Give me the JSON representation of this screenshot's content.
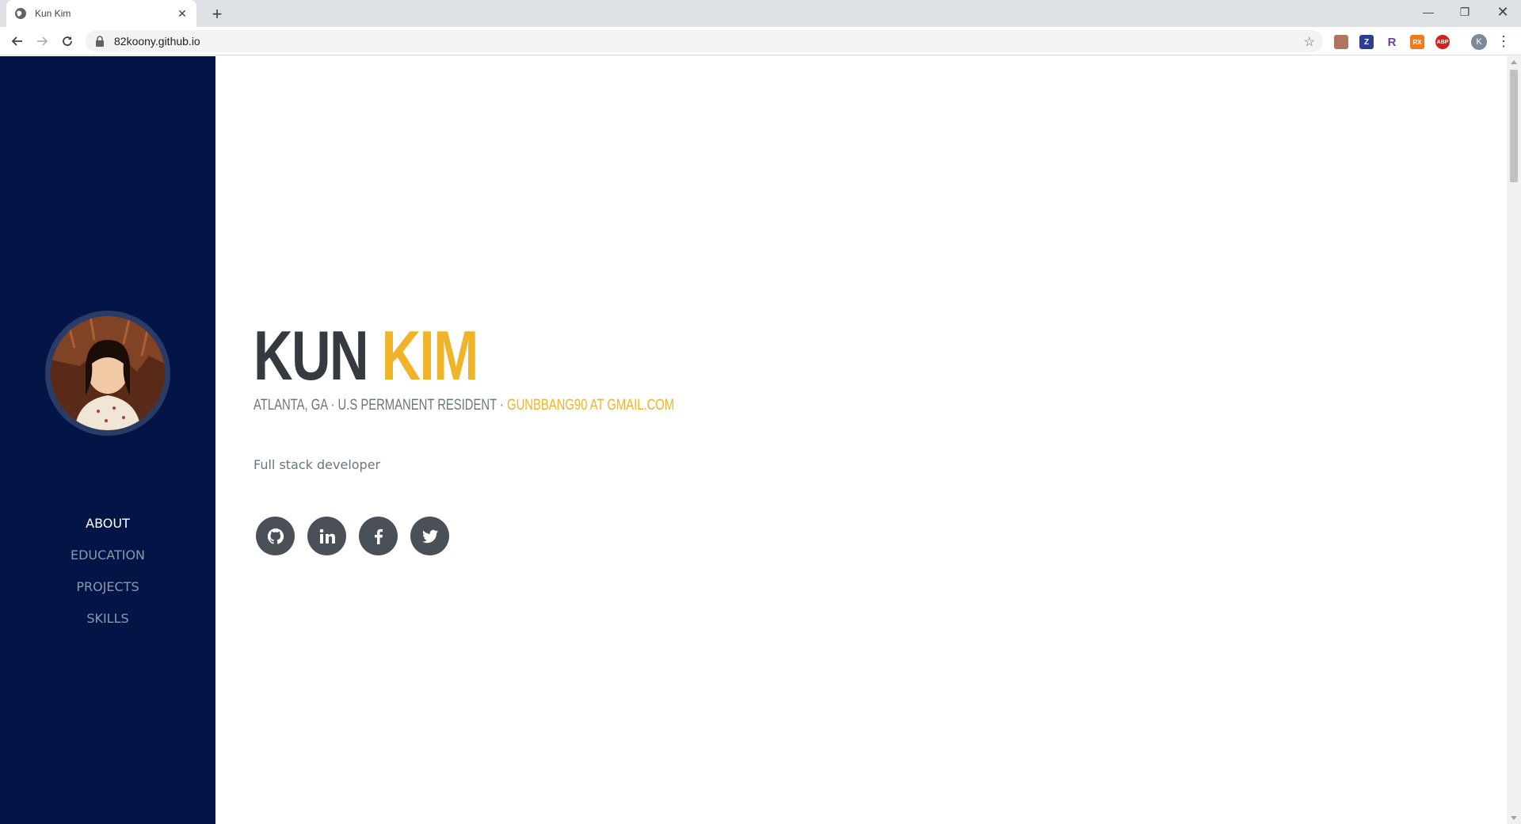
{
  "browser": {
    "tab_title": "Kun Kim",
    "url": "82koony.github.io",
    "profile_initial": "K",
    "extensions": [
      {
        "name": "pdf-extension-icon",
        "label": "",
        "color": "#b07560"
      },
      {
        "name": "zotero-extension-icon",
        "label": "Z",
        "color": "#2c3e8f"
      },
      {
        "name": "r-extension-icon",
        "label": "R",
        "color": "#ffffff"
      },
      {
        "name": "rx-extension-icon",
        "label": "RX",
        "color": "#f07b1c"
      },
      {
        "name": "abp-extension-icon",
        "label": "ABP",
        "color": "#d21f1f"
      }
    ]
  },
  "sidebar": {
    "nav": [
      {
        "label": "About",
        "active": true
      },
      {
        "label": "Education",
        "active": false
      },
      {
        "label": "Projects",
        "active": false
      },
      {
        "label": "Skills",
        "active": false
      }
    ]
  },
  "about": {
    "first_name": "KUN",
    "last_name": "KIM",
    "location": "ATLANTA, GA · U.S PERMANENT RESIDENT · ",
    "email": "GUNBBANG90 AT GMAIL.COM",
    "lead": "Full stack developer",
    "social": [
      "github-icon",
      "linkedin-icon",
      "facebook-icon",
      "twitter-icon"
    ]
  },
  "colors": {
    "sidebar_bg": "#031547",
    "accent": "#f0b429",
    "heading": "#343a40",
    "muted": "#6c757d",
    "social_bg": "#495057"
  }
}
